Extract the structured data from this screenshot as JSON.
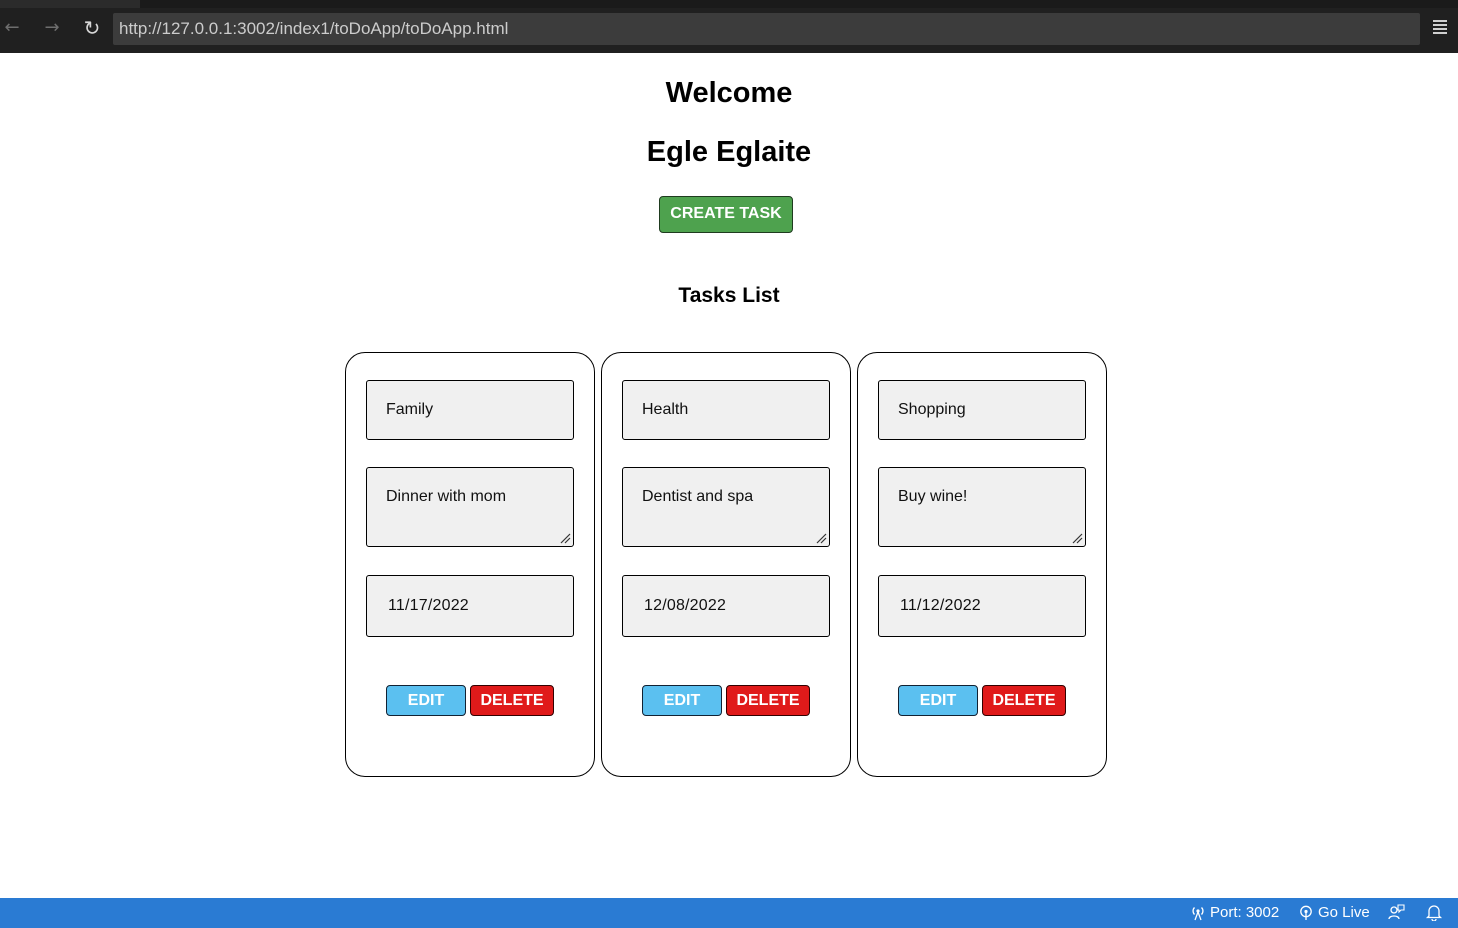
{
  "browser": {
    "url": "http://127.0.0.1:3002/index1/toDoApp/toDoApp.html",
    "back_icon": "arrow-left-icon",
    "forward_icon": "arrow-right-icon",
    "reload_icon": "reload-icon",
    "menu_icon": "hamburger-menu-icon"
  },
  "page": {
    "welcome": "Welcome",
    "user_name": "Egle Eglaite",
    "create_button": "CREATE TASK",
    "tasks_heading": "Tasks List"
  },
  "tasks": [
    {
      "category": "Family",
      "description": "Dinner with mom",
      "date": "11/17/2022",
      "edit": "EDIT",
      "delete": "DELETE"
    },
    {
      "category": "Health",
      "description": "Dentist and spa",
      "date": "12/08/2022",
      "edit": "EDIT",
      "delete": "DELETE"
    },
    {
      "category": "Shopping",
      "description": "Buy wine!",
      "date": "11/12/2022",
      "edit": "EDIT",
      "delete": "DELETE"
    }
  ],
  "status_bar": {
    "port": "Port: 3002",
    "go_live": "Go Live",
    "colors": {
      "background": "#2a7bd3"
    }
  },
  "colors": {
    "create_button": "#4ea24e",
    "edit_button": "#5bc0f0",
    "delete_button": "#e01a1a"
  }
}
